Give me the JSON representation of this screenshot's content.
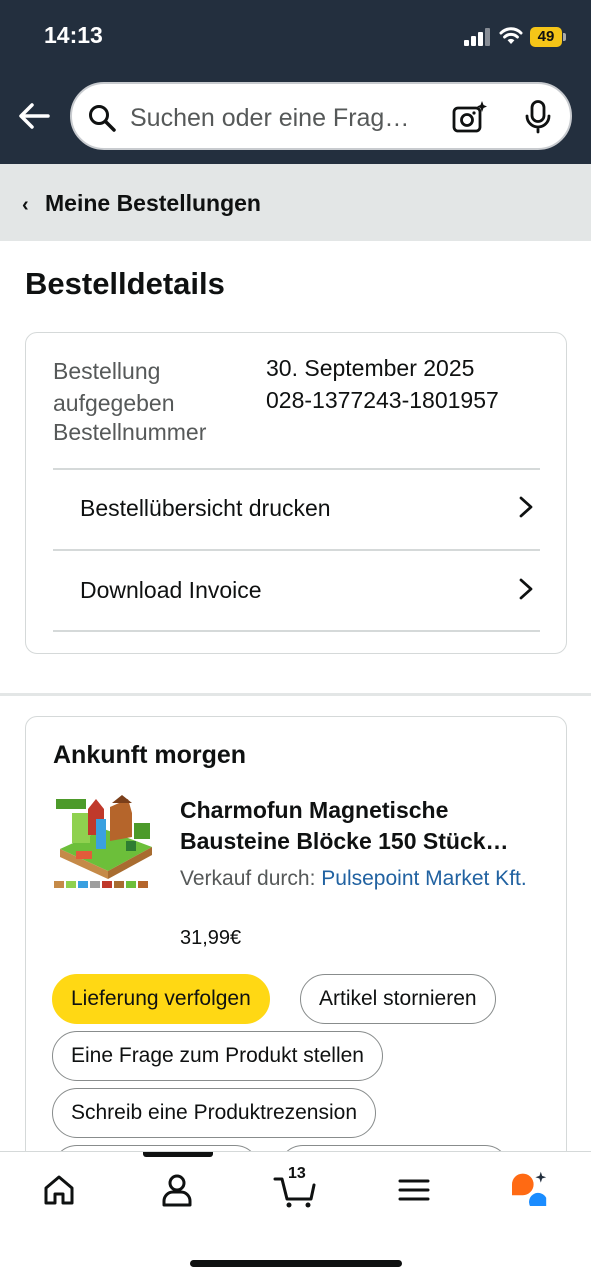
{
  "status_bar": {
    "time": "14:13",
    "battery": "49"
  },
  "search": {
    "placeholder": "Suchen oder eine Frag…"
  },
  "breadcrumb": {
    "chevron": "‹",
    "label": "Meine Bestellungen"
  },
  "page": {
    "title": "Bestelldetails"
  },
  "order_info": {
    "placed_label": "Bestellung aufgegeben",
    "placed_value": "30. September 2025",
    "number_label": "Bestellnummer",
    "number_value": "028-1377243-1801957",
    "links": [
      {
        "label": "Bestellübersicht drucken"
      },
      {
        "label": "Download Invoice"
      }
    ]
  },
  "shipment": {
    "status": "Ankunft morgen",
    "product": {
      "title_line1": "Charmofun Magnetische",
      "title_line2": "Bausteine Blöcke 150 Stück…",
      "seller_prefix": "Verkauf durch:",
      "seller_name": "Pulsepoint Market Kft.",
      "price": "31,99€"
    },
    "actions": [
      {
        "label": "Lieferung verfolgen"
      },
      {
        "label": "Artikel stornieren"
      },
      {
        "label": "Eine Frage zum Produkt stellen"
      },
      {
        "label": "Schreib eine Produktrezension"
      }
    ]
  },
  "bottom_nav": {
    "items": [
      "home-icon",
      "account-icon",
      "cart-icon",
      "menu-icon",
      "rufus-assistant-icon"
    ],
    "cart_count": "13"
  },
  "colors": {
    "header_bg": "#232f3e",
    "primary_button": "#ffd814",
    "link": "#2162a1",
    "crumb_bg": "#e3e6e6"
  }
}
